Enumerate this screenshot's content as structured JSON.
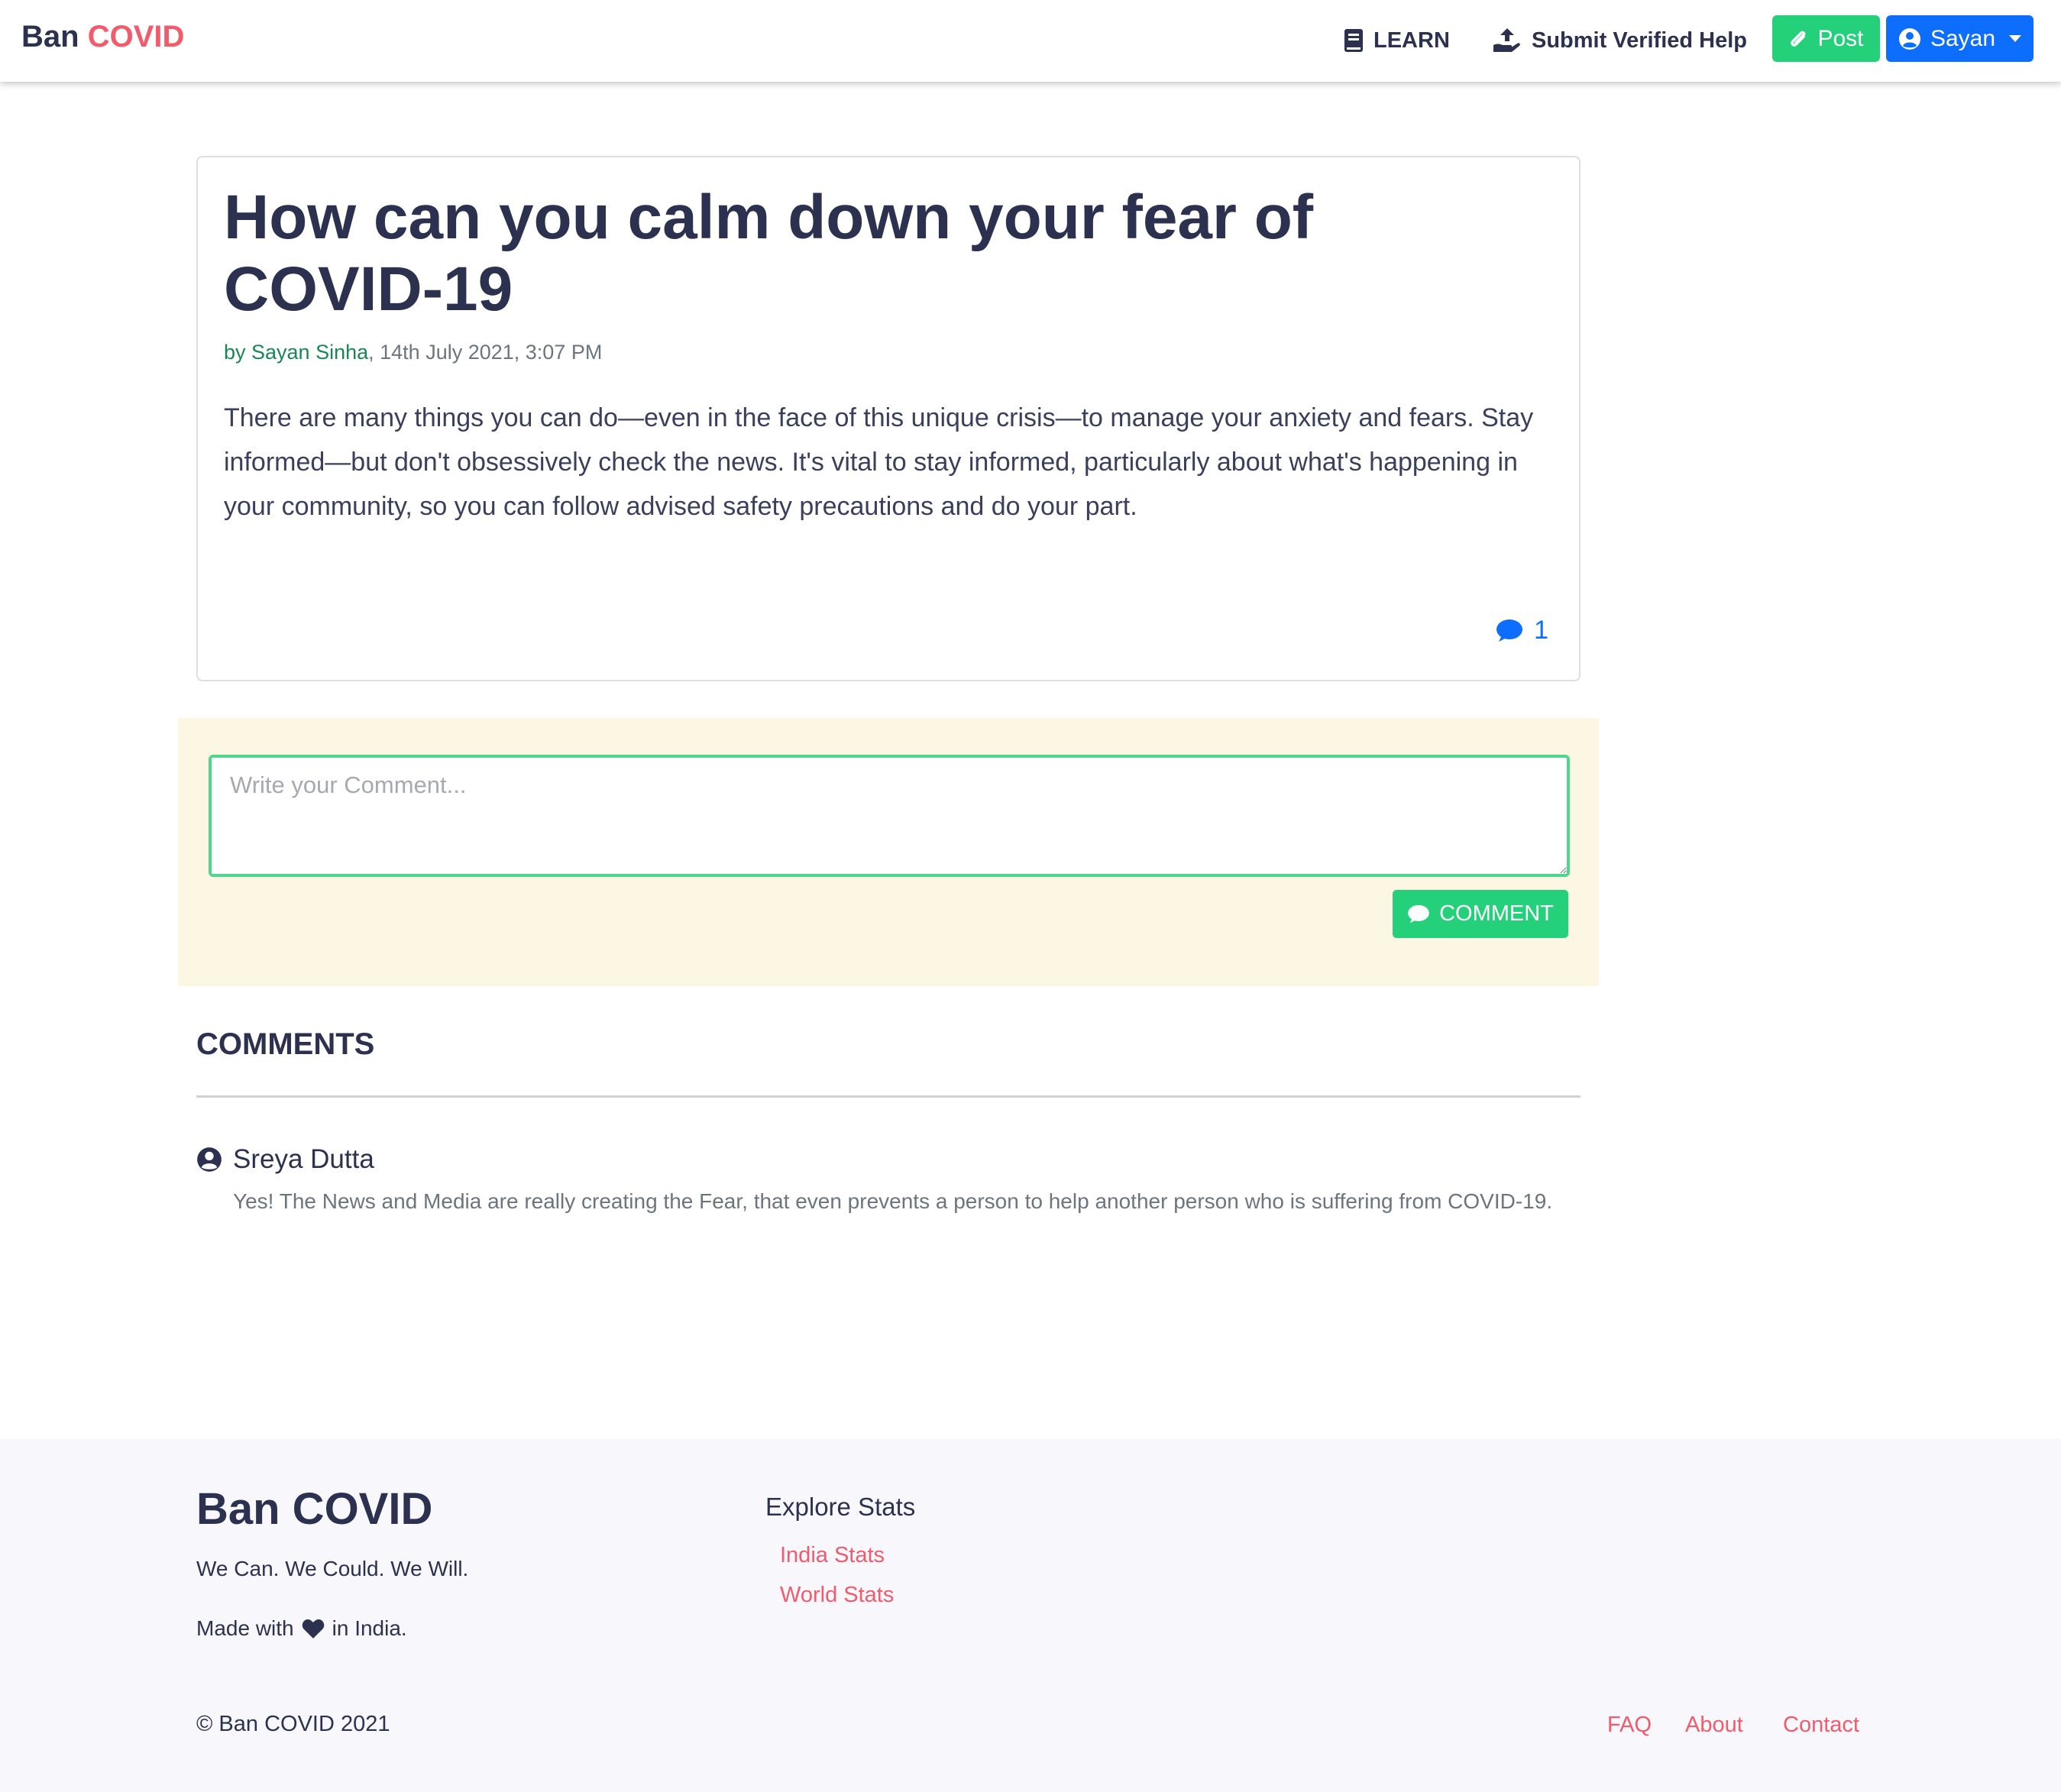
{
  "navbar": {
    "brand_main": "Ban",
    "brand_accent": "COVID",
    "learn_label": "LEARN",
    "submit_help_label": "Submit Verified Help",
    "post_label": "Post",
    "user_label": "Sayan"
  },
  "post": {
    "title": "How can you calm down your fear of COVID-19",
    "author": "by Sayan Sinha",
    "date": ", 14th July 2021, 3:07 PM",
    "body": "There are many things you can do—even in the face of this unique crisis—to manage your anxiety and fears. Stay informed—but don't obsessively check the news. It's vital to stay informed, particularly about what's happening in your community, so you can follow advised safety precautions and do your part.",
    "comment_count": "1"
  },
  "comment_form": {
    "placeholder": "Write your Comment...",
    "value": "",
    "submit_label": "COMMENT"
  },
  "comments": {
    "heading": "COMMENTS",
    "items": [
      {
        "author": "Sreya Dutta",
        "text": "Yes! The News and Media are really creating the Fear, that even prevents a person to help another person who is suffering from COVID-19."
      }
    ]
  },
  "footer": {
    "brand": "Ban COVID",
    "tagline": "We Can. We Could. We Will.",
    "made_prefix": "Made with",
    "made_suffix": "in India.",
    "explore_heading": "Explore Stats",
    "explore_links": [
      "India Stats",
      "World Stats"
    ],
    "copyright": "© Ban COVID 2021",
    "bottom_links": [
      "FAQ",
      "About",
      "Contact"
    ]
  },
  "colors": {
    "brand_accent": "#f15b6c",
    "success_green": "#25d07b",
    "primary_blue": "#0d6efd",
    "heading_navy": "#2d3150",
    "comment_area_bg": "#fcf7e3",
    "footer_bg": "#f8f7fc"
  },
  "icons": {
    "learn": "book-icon",
    "submit_help": "hand-holding-upload-icon",
    "post": "paperclip-icon",
    "user": "user-circle-icon",
    "comment_count": "speech-bubble-icon",
    "comment_button": "speech-bubble-icon",
    "comment_author": "user-circle-icon",
    "made_with": "heart-icon"
  }
}
